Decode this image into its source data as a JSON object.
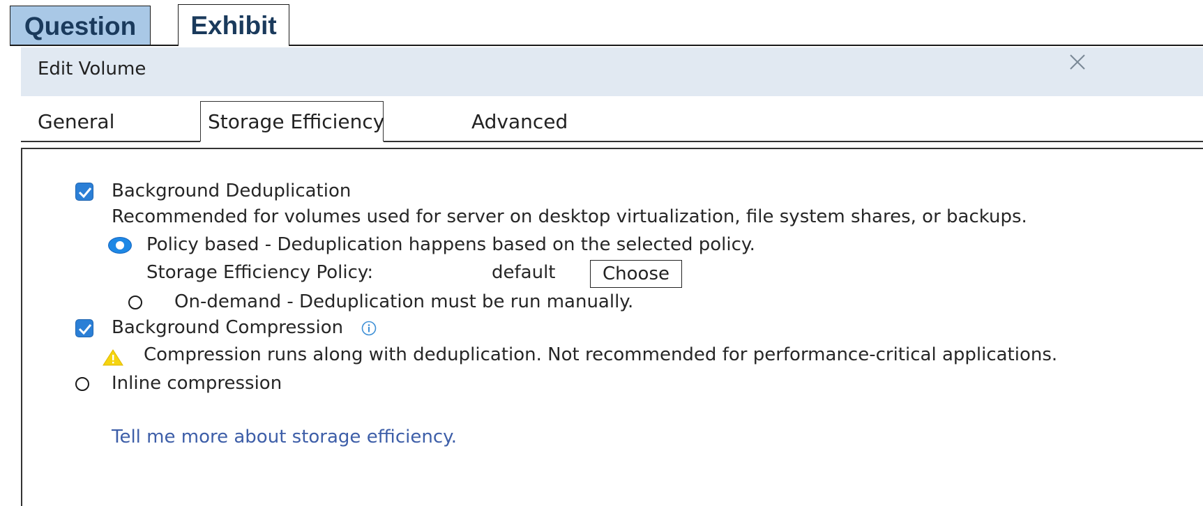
{
  "outer_tabs": {
    "question_label": "Question",
    "exhibit_label": "Exhibit"
  },
  "dialog": {
    "title": "Edit Volume",
    "close_icon": "close-icon"
  },
  "inner_tabs": [
    {
      "label": "General",
      "active": false
    },
    {
      "label": "Storage Efficiency",
      "active": true
    },
    {
      "label": "Advanced",
      "active": false
    }
  ],
  "content": {
    "background_dedup": {
      "label": "Background Deduplication",
      "checked": true,
      "description": "Recommended for volumes used for server on desktop virtualization, file system shares, or backups."
    },
    "policy_based": {
      "label": "Policy based - Deduplication happens based on the selected policy.",
      "selected": true
    },
    "policy": {
      "label": "Storage Efficiency Policy:",
      "value": "default",
      "choose_label": "Choose"
    },
    "on_demand": {
      "label": "On-demand - Deduplication must be run manually.",
      "selected": false
    },
    "background_compression": {
      "label": "Background Compression",
      "checked": true,
      "info_icon": "info-icon",
      "warning_icon": "warning-icon",
      "warning": "Compression runs along with deduplication. Not recommended for performance-critical applications."
    },
    "inline_compression": {
      "label": "Inline compression",
      "selected": false
    },
    "learn_more": "Tell me more about storage efficiency."
  },
  "colors": {
    "question_tab_bg": "#a9c8e6",
    "header_bg": "#e1e9f2",
    "checkbox_blue": "#2b7fd6",
    "link_blue": "#3d5ea8",
    "warning_yellow": "#f5d40f"
  }
}
